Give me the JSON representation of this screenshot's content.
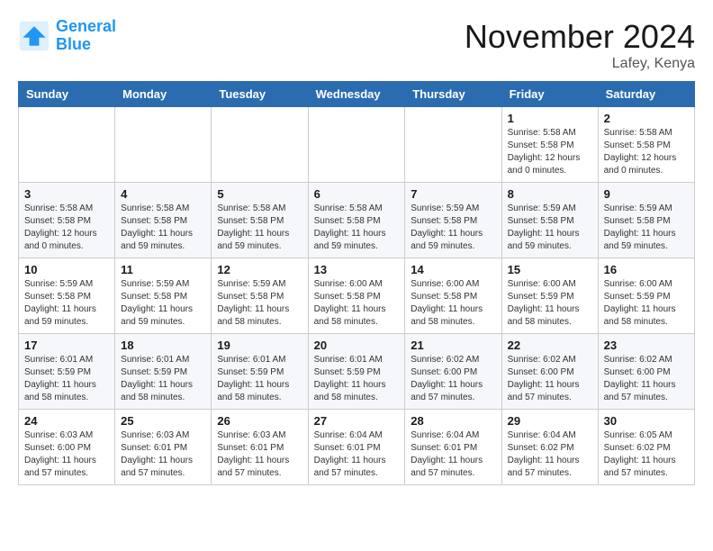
{
  "logo": {
    "line1": "General",
    "line2": "Blue"
  },
  "title": "November 2024",
  "location": "Lafey, Kenya",
  "days_of_week": [
    "Sunday",
    "Monday",
    "Tuesday",
    "Wednesday",
    "Thursday",
    "Friday",
    "Saturday"
  ],
  "weeks": [
    [
      {
        "day": "",
        "info": ""
      },
      {
        "day": "",
        "info": ""
      },
      {
        "day": "",
        "info": ""
      },
      {
        "day": "",
        "info": ""
      },
      {
        "day": "",
        "info": ""
      },
      {
        "day": "1",
        "info": "Sunrise: 5:58 AM\nSunset: 5:58 PM\nDaylight: 12 hours\nand 0 minutes."
      },
      {
        "day": "2",
        "info": "Sunrise: 5:58 AM\nSunset: 5:58 PM\nDaylight: 12 hours\nand 0 minutes."
      }
    ],
    [
      {
        "day": "3",
        "info": "Sunrise: 5:58 AM\nSunset: 5:58 PM\nDaylight: 12 hours\nand 0 minutes."
      },
      {
        "day": "4",
        "info": "Sunrise: 5:58 AM\nSunset: 5:58 PM\nDaylight: 11 hours\nand 59 minutes."
      },
      {
        "day": "5",
        "info": "Sunrise: 5:58 AM\nSunset: 5:58 PM\nDaylight: 11 hours\nand 59 minutes."
      },
      {
        "day": "6",
        "info": "Sunrise: 5:58 AM\nSunset: 5:58 PM\nDaylight: 11 hours\nand 59 minutes."
      },
      {
        "day": "7",
        "info": "Sunrise: 5:59 AM\nSunset: 5:58 PM\nDaylight: 11 hours\nand 59 minutes."
      },
      {
        "day": "8",
        "info": "Sunrise: 5:59 AM\nSunset: 5:58 PM\nDaylight: 11 hours\nand 59 minutes."
      },
      {
        "day": "9",
        "info": "Sunrise: 5:59 AM\nSunset: 5:58 PM\nDaylight: 11 hours\nand 59 minutes."
      }
    ],
    [
      {
        "day": "10",
        "info": "Sunrise: 5:59 AM\nSunset: 5:58 PM\nDaylight: 11 hours\nand 59 minutes."
      },
      {
        "day": "11",
        "info": "Sunrise: 5:59 AM\nSunset: 5:58 PM\nDaylight: 11 hours\nand 59 minutes."
      },
      {
        "day": "12",
        "info": "Sunrise: 5:59 AM\nSunset: 5:58 PM\nDaylight: 11 hours\nand 58 minutes."
      },
      {
        "day": "13",
        "info": "Sunrise: 6:00 AM\nSunset: 5:58 PM\nDaylight: 11 hours\nand 58 minutes."
      },
      {
        "day": "14",
        "info": "Sunrise: 6:00 AM\nSunset: 5:58 PM\nDaylight: 11 hours\nand 58 minutes."
      },
      {
        "day": "15",
        "info": "Sunrise: 6:00 AM\nSunset: 5:59 PM\nDaylight: 11 hours\nand 58 minutes."
      },
      {
        "day": "16",
        "info": "Sunrise: 6:00 AM\nSunset: 5:59 PM\nDaylight: 11 hours\nand 58 minutes."
      }
    ],
    [
      {
        "day": "17",
        "info": "Sunrise: 6:01 AM\nSunset: 5:59 PM\nDaylight: 11 hours\nand 58 minutes."
      },
      {
        "day": "18",
        "info": "Sunrise: 6:01 AM\nSunset: 5:59 PM\nDaylight: 11 hours\nand 58 minutes."
      },
      {
        "day": "19",
        "info": "Sunrise: 6:01 AM\nSunset: 5:59 PM\nDaylight: 11 hours\nand 58 minutes."
      },
      {
        "day": "20",
        "info": "Sunrise: 6:01 AM\nSunset: 5:59 PM\nDaylight: 11 hours\nand 58 minutes."
      },
      {
        "day": "21",
        "info": "Sunrise: 6:02 AM\nSunset: 6:00 PM\nDaylight: 11 hours\nand 57 minutes."
      },
      {
        "day": "22",
        "info": "Sunrise: 6:02 AM\nSunset: 6:00 PM\nDaylight: 11 hours\nand 57 minutes."
      },
      {
        "day": "23",
        "info": "Sunrise: 6:02 AM\nSunset: 6:00 PM\nDaylight: 11 hours\nand 57 minutes."
      }
    ],
    [
      {
        "day": "24",
        "info": "Sunrise: 6:03 AM\nSunset: 6:00 PM\nDaylight: 11 hours\nand 57 minutes."
      },
      {
        "day": "25",
        "info": "Sunrise: 6:03 AM\nSunset: 6:01 PM\nDaylight: 11 hours\nand 57 minutes."
      },
      {
        "day": "26",
        "info": "Sunrise: 6:03 AM\nSunset: 6:01 PM\nDaylight: 11 hours\nand 57 minutes."
      },
      {
        "day": "27",
        "info": "Sunrise: 6:04 AM\nSunset: 6:01 PM\nDaylight: 11 hours\nand 57 minutes."
      },
      {
        "day": "28",
        "info": "Sunrise: 6:04 AM\nSunset: 6:01 PM\nDaylight: 11 hours\nand 57 minutes."
      },
      {
        "day": "29",
        "info": "Sunrise: 6:04 AM\nSunset: 6:02 PM\nDaylight: 11 hours\nand 57 minutes."
      },
      {
        "day": "30",
        "info": "Sunrise: 6:05 AM\nSunset: 6:02 PM\nDaylight: 11 hours\nand 57 minutes."
      }
    ]
  ]
}
